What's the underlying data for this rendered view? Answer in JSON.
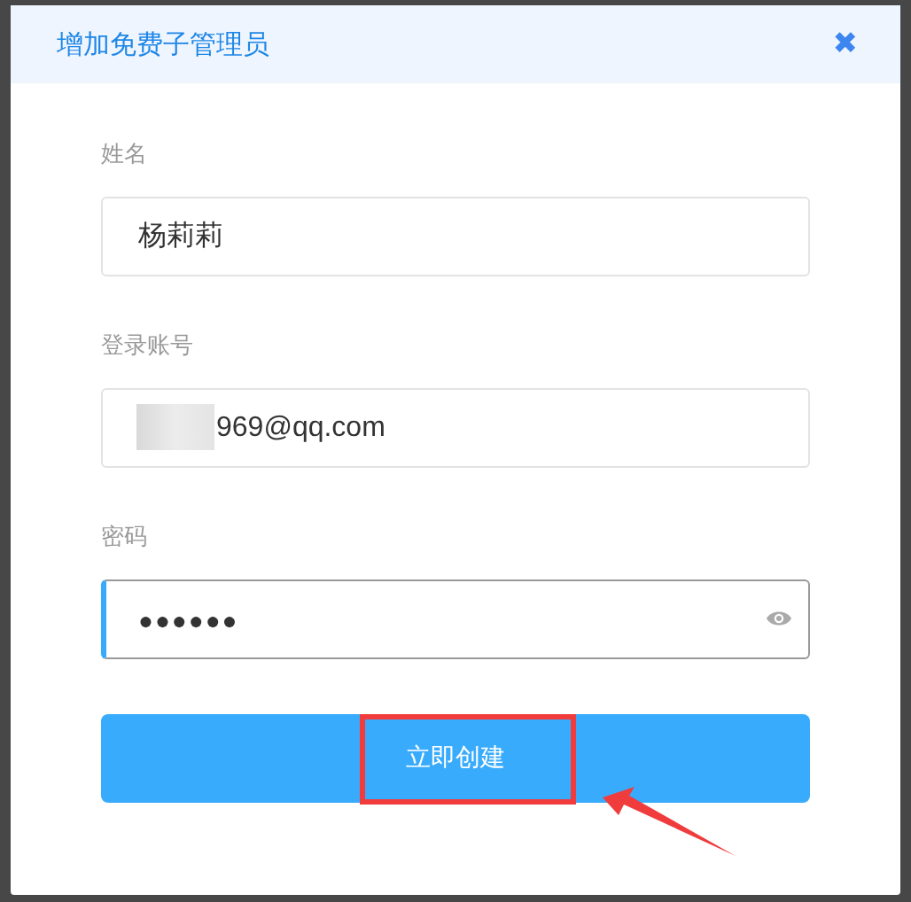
{
  "dialog": {
    "title": "增加免费子管理员",
    "close": "✖"
  },
  "fields": [
    {
      "label": "姓名",
      "value": "杨莉莉",
      "focused": false,
      "kind": "text"
    },
    {
      "label": "登录账号",
      "value": "969@qq.com",
      "focused": false,
      "kind": "text",
      "redacted": true
    },
    {
      "label": "密码",
      "value": "●●●●●●",
      "focused": true,
      "kind": "password"
    }
  ],
  "submit": {
    "label": "立即创建"
  },
  "annotation": {
    "highlight": true,
    "arrow": true
  }
}
